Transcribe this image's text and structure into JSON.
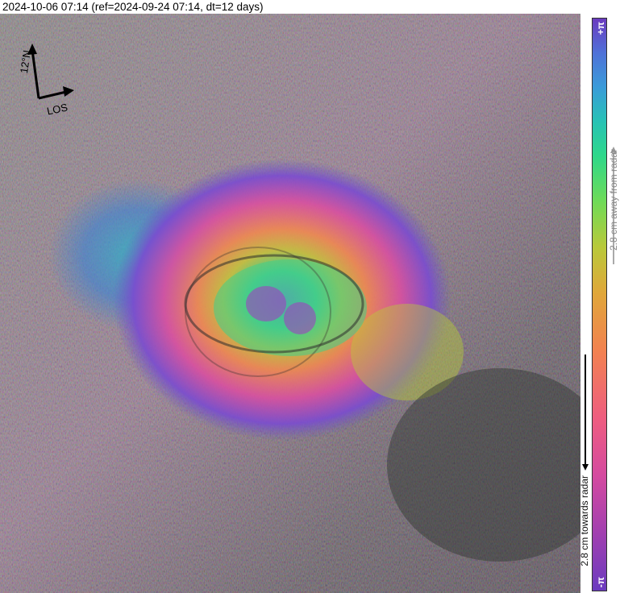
{
  "header": {
    "title": "2024-10-06 07:14 (ref=2024-09-24 07:14, dt=12 days)"
  },
  "compass": {
    "north_label": "12°N",
    "los_label": "LOS"
  },
  "colorbar": {
    "top_label": "+π",
    "bottom_label": "-π",
    "away_label": "2.8 cm away from radar",
    "towards_label": "2.8 cm towards radar",
    "colors": [
      "#6b3bbf",
      "#d44aa0",
      "#f28250",
      "#b9c93a",
      "#2ed88a",
      "#3a9bd9",
      "#4f71d8"
    ]
  }
}
